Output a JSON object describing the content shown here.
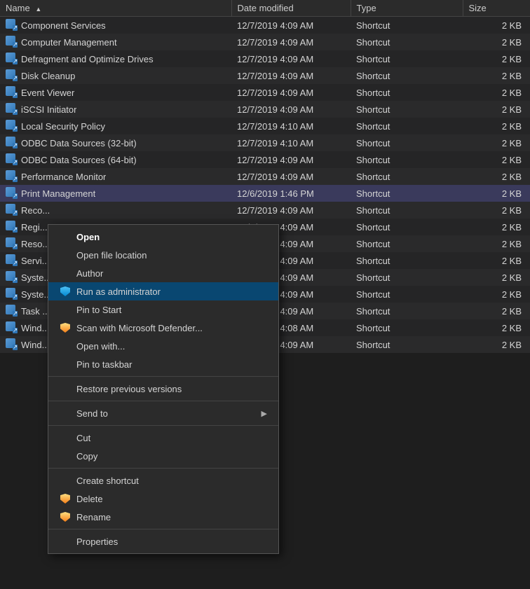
{
  "columns": {
    "name": "Name",
    "date": "Date modified",
    "type": "Type",
    "size": "Size"
  },
  "files": [
    {
      "name": "Component Services",
      "date": "12/7/2019 4:09 AM",
      "type": "Shortcut",
      "size": "2 KB",
      "highlight": false
    },
    {
      "name": "Computer Management",
      "date": "12/7/2019 4:09 AM",
      "type": "Shortcut",
      "size": "2 KB",
      "highlight": false
    },
    {
      "name": "Defragment and Optimize Drives",
      "date": "12/7/2019 4:09 AM",
      "type": "Shortcut",
      "size": "2 KB",
      "highlight": false
    },
    {
      "name": "Disk Cleanup",
      "date": "12/7/2019 4:09 AM",
      "type": "Shortcut",
      "size": "2 KB",
      "highlight": false
    },
    {
      "name": "Event Viewer",
      "date": "12/7/2019 4:09 AM",
      "type": "Shortcut",
      "size": "2 KB",
      "highlight": false
    },
    {
      "name": "iSCSI Initiator",
      "date": "12/7/2019 4:09 AM",
      "type": "Shortcut",
      "size": "2 KB",
      "highlight": false
    },
    {
      "name": "Local Security Policy",
      "date": "12/7/2019 4:10 AM",
      "type": "Shortcut",
      "size": "2 KB",
      "highlight": false
    },
    {
      "name": "ODBC Data Sources (32-bit)",
      "date": "12/7/2019 4:10 AM",
      "type": "Shortcut",
      "size": "2 KB",
      "highlight": false
    },
    {
      "name": "ODBC Data Sources (64-bit)",
      "date": "12/7/2019 4:09 AM",
      "type": "Shortcut",
      "size": "2 KB",
      "highlight": false
    },
    {
      "name": "Performance Monitor",
      "date": "12/7/2019 4:09 AM",
      "type": "Shortcut",
      "size": "2 KB",
      "highlight": false
    },
    {
      "name": "Print Management",
      "date": "12/6/2019 1:46 PM",
      "type": "Shortcut",
      "size": "2 KB",
      "highlight": true
    },
    {
      "name": "Reco...",
      "date": "12/7/2019 4:09 AM",
      "type": "Shortcut",
      "size": "2 KB",
      "highlight": false
    },
    {
      "name": "Regi...",
      "date": "12/7/2019 4:09 AM",
      "type": "Shortcut",
      "size": "2 KB",
      "highlight": false
    },
    {
      "name": "Reso...",
      "date": "12/7/2019 4:09 AM",
      "type": "Shortcut",
      "size": "2 KB",
      "highlight": false
    },
    {
      "name": "Servi...",
      "date": "12/7/2019 4:09 AM",
      "type": "Shortcut",
      "size": "2 KB",
      "highlight": false
    },
    {
      "name": "Syste...",
      "date": "12/7/2019 4:09 AM",
      "type": "Shortcut",
      "size": "2 KB",
      "highlight": false
    },
    {
      "name": "Syste...",
      "date": "12/7/2019 4:09 AM",
      "type": "Shortcut",
      "size": "2 KB",
      "highlight": false
    },
    {
      "name": "Task ...",
      "date": "12/7/2019 4:09 AM",
      "type": "Shortcut",
      "size": "2 KB",
      "highlight": false
    },
    {
      "name": "Wind...",
      "date": "12/7/2019 4:08 AM",
      "type": "Shortcut",
      "size": "2 KB",
      "highlight": false
    },
    {
      "name": "Wind...",
      "date": "12/7/2019 4:09 AM",
      "type": "Shortcut",
      "size": "2 KB",
      "highlight": false
    }
  ],
  "contextMenu": {
    "items": [
      {
        "id": "open",
        "label": "Open",
        "icon": null,
        "hasSubmenu": false,
        "separator_after": false,
        "bold": true,
        "highlighted": false
      },
      {
        "id": "open-file-loc",
        "label": "Open file location",
        "icon": null,
        "hasSubmenu": false,
        "separator_after": false,
        "bold": false,
        "highlighted": false
      },
      {
        "id": "author",
        "label": "Author",
        "icon": null,
        "hasSubmenu": false,
        "separator_after": false,
        "bold": false,
        "highlighted": false
      },
      {
        "id": "run-as-admin",
        "label": "Run as administrator",
        "icon": "shield-blue",
        "hasSubmenu": false,
        "separator_after": false,
        "bold": false,
        "highlighted": true
      },
      {
        "id": "pin-to-start",
        "label": "Pin to Start",
        "icon": null,
        "hasSubmenu": false,
        "separator_after": false,
        "bold": false,
        "highlighted": false
      },
      {
        "id": "scan-defender",
        "label": "Scan with Microsoft Defender...",
        "icon": "shield-yellow",
        "hasSubmenu": false,
        "separator_after": false,
        "bold": false,
        "highlighted": false
      },
      {
        "id": "open-with",
        "label": "Open with...",
        "icon": null,
        "hasSubmenu": false,
        "separator_after": false,
        "bold": false,
        "highlighted": false
      },
      {
        "id": "pin-taskbar",
        "label": "Pin to taskbar",
        "icon": null,
        "hasSubmenu": false,
        "separator_after": true,
        "bold": false,
        "highlighted": false
      },
      {
        "id": "restore-prev",
        "label": "Restore previous versions",
        "icon": null,
        "hasSubmenu": false,
        "separator_after": true,
        "bold": false,
        "highlighted": false
      },
      {
        "id": "send-to",
        "label": "Send to",
        "icon": null,
        "hasSubmenu": true,
        "separator_after": true,
        "bold": false,
        "highlighted": false
      },
      {
        "id": "cut",
        "label": "Cut",
        "icon": null,
        "hasSubmenu": false,
        "separator_after": false,
        "bold": false,
        "highlighted": false
      },
      {
        "id": "copy",
        "label": "Copy",
        "icon": null,
        "hasSubmenu": false,
        "separator_after": true,
        "bold": false,
        "highlighted": false
      },
      {
        "id": "create-shortcut",
        "label": "Create shortcut",
        "icon": null,
        "hasSubmenu": false,
        "separator_after": false,
        "bold": false,
        "highlighted": false
      },
      {
        "id": "delete",
        "label": "Delete",
        "icon": "shield-yellow",
        "hasSubmenu": false,
        "separator_after": false,
        "bold": false,
        "highlighted": false
      },
      {
        "id": "rename",
        "label": "Rename",
        "icon": "shield-yellow",
        "hasSubmenu": false,
        "separator_after": true,
        "bold": false,
        "highlighted": false
      },
      {
        "id": "properties",
        "label": "Properties",
        "icon": null,
        "hasSubmenu": false,
        "separator_after": false,
        "bold": false,
        "highlighted": false
      }
    ]
  }
}
